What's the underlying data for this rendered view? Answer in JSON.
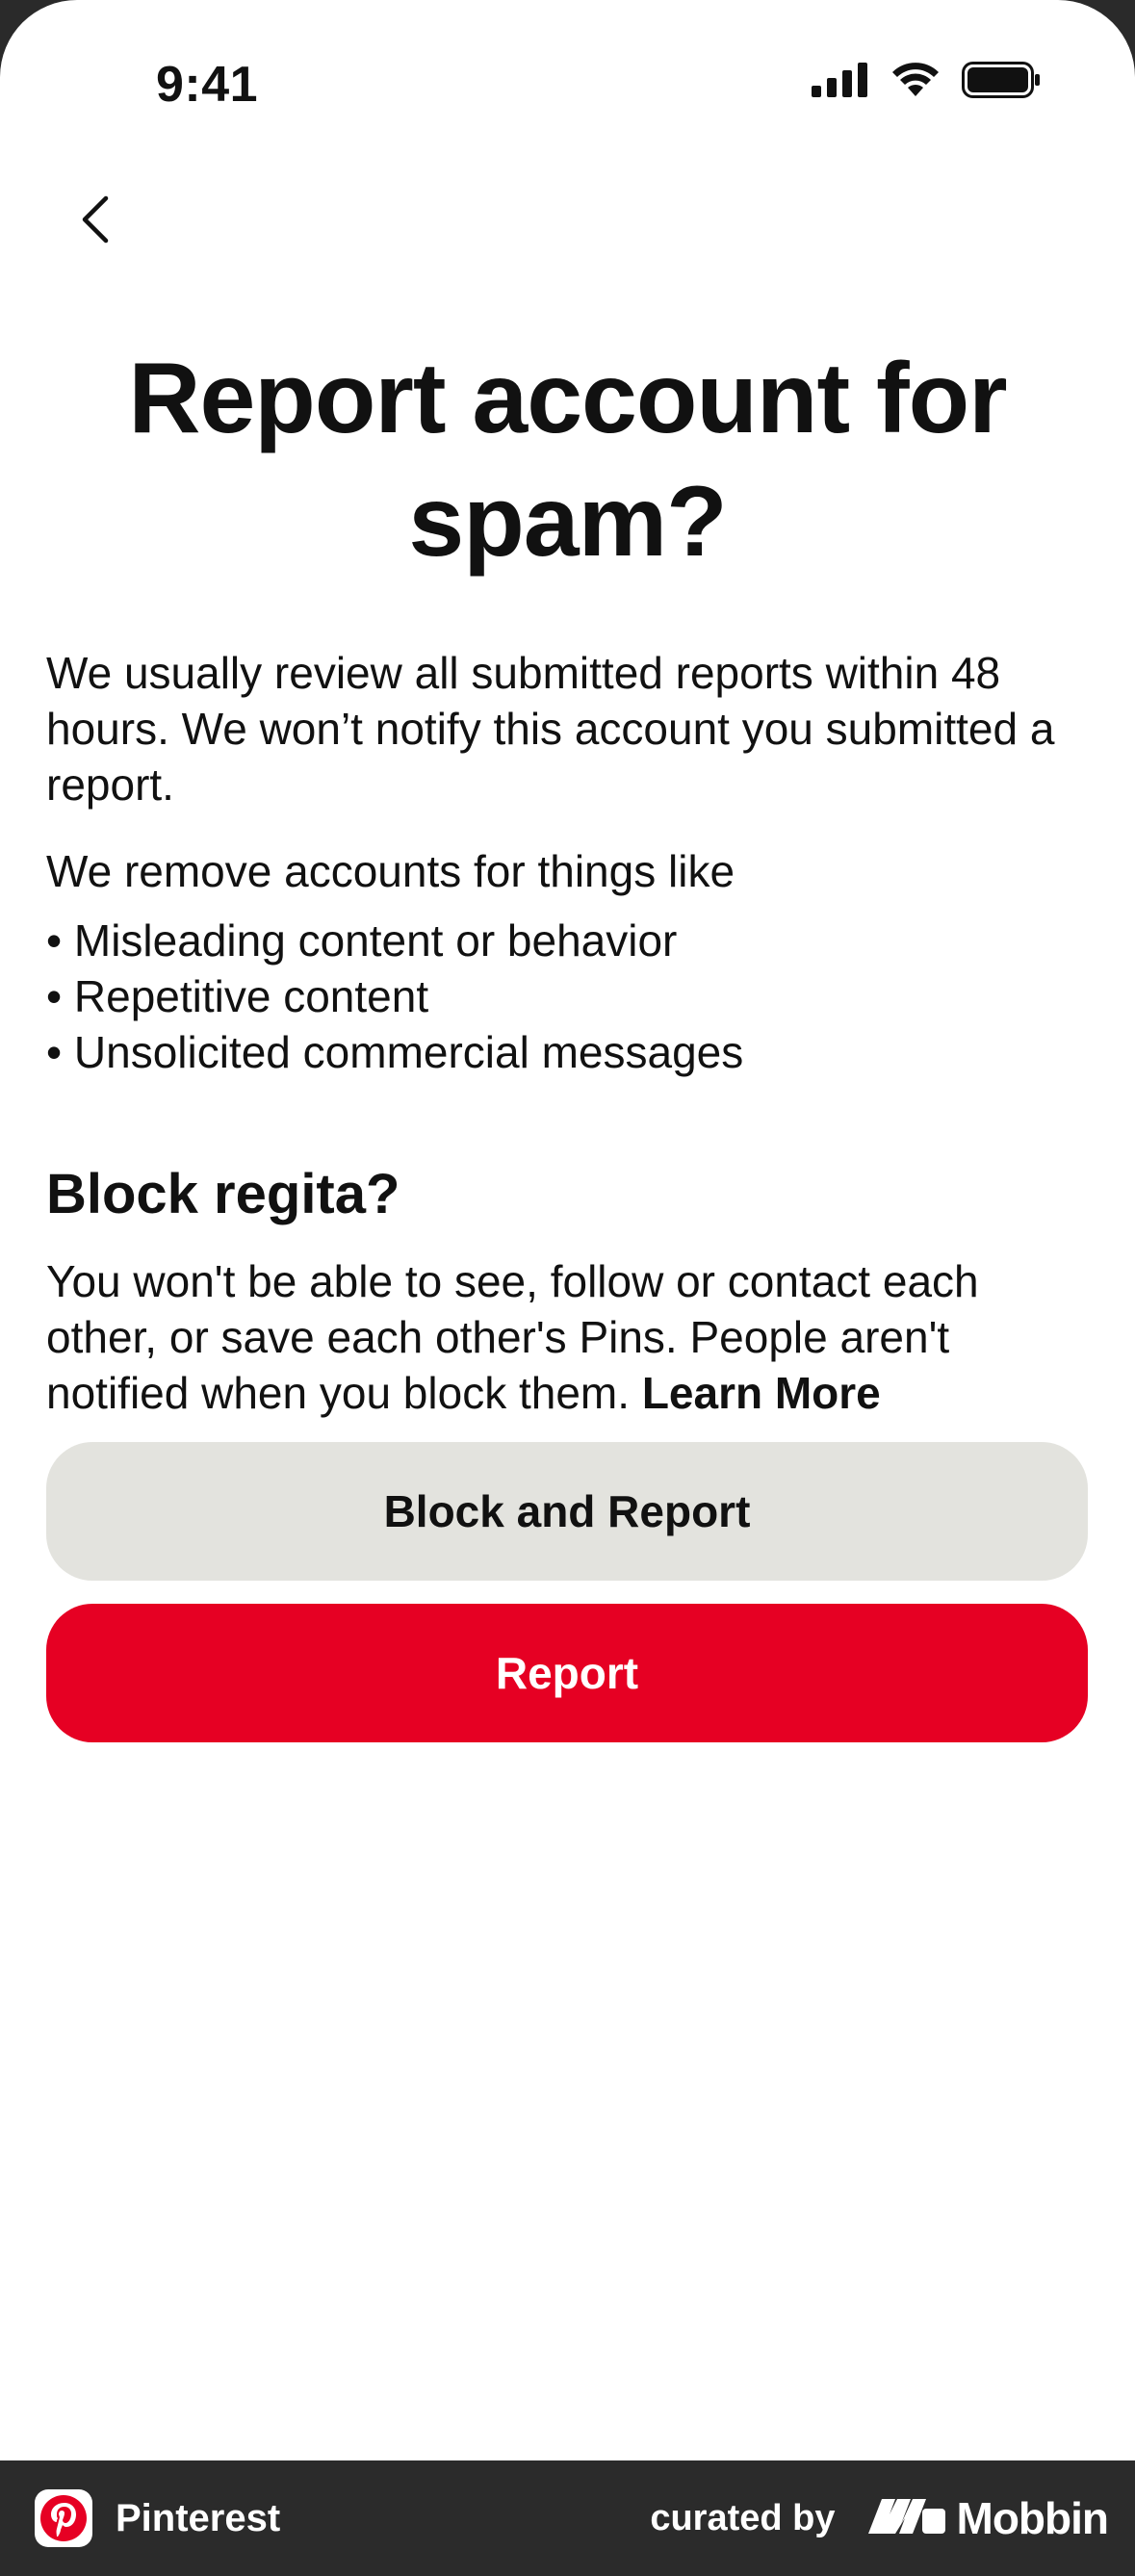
{
  "status_bar": {
    "time": "9:41"
  },
  "header": {
    "back_icon": "chevron-left-icon"
  },
  "main": {
    "title": "Report account for spam?",
    "intro": "We usually review all submitted reports within 48 hours. We won’t notify this account you submitted a report.",
    "list_heading": "We remove accounts for things like",
    "reasons": [
      "Misleading content or behavior",
      "Repetitive content",
      "Unsolicited commercial messages"
    ],
    "block_title": "Block regita?",
    "block_text": "You won't be able to see, follow or contact each other, or save each other's Pins. People aren't notified when you block them.",
    "learn_more": "Learn More"
  },
  "actions": {
    "block_and_report_label": "Block and Report",
    "report_label": "Report"
  },
  "footer": {
    "app_name": "Pinterest",
    "curated_by": "curated by",
    "brand": "Mobbin"
  },
  "colors": {
    "primary": "#e60023",
    "secondary_bg": "#e3e3de",
    "text": "#111111",
    "footer_bg": "#2b2b2b"
  }
}
